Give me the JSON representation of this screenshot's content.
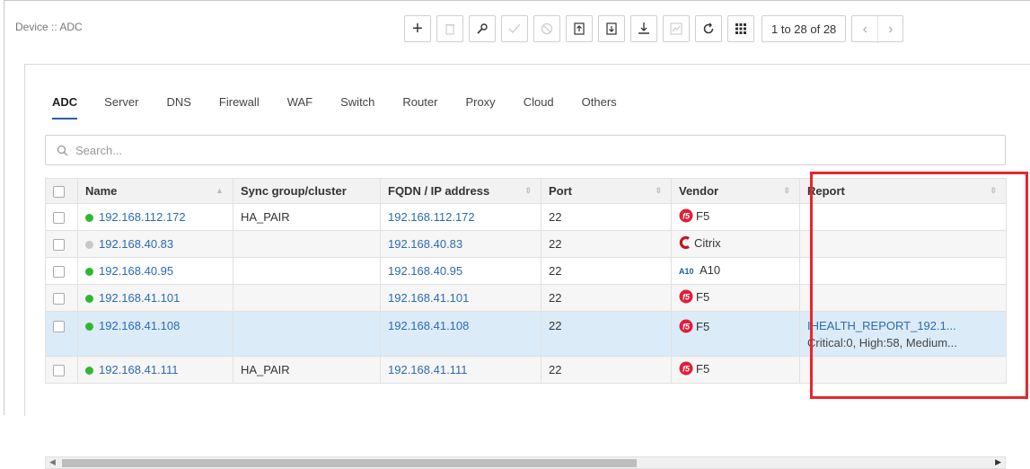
{
  "breadcrumb": "Device :: ADC",
  "toolbar": {
    "buttons": [
      "add-icon",
      "delete-icon",
      "key-icon",
      "check-icon",
      "disable-icon",
      "import-icon",
      "export-icon",
      "download-icon",
      "report-icon",
      "refresh-icon",
      "columns-icon"
    ],
    "add_label": "+",
    "pager_text": "1 to 28 of 28",
    "prev_label": "‹",
    "next_label": "›"
  },
  "tabs": [
    {
      "label": "ADC",
      "active": true
    },
    {
      "label": "Server"
    },
    {
      "label": "DNS"
    },
    {
      "label": "Firewall"
    },
    {
      "label": "WAF"
    },
    {
      "label": "Switch"
    },
    {
      "label": "Router"
    },
    {
      "label": "Proxy"
    },
    {
      "label": "Cloud"
    },
    {
      "label": "Others"
    }
  ],
  "search": {
    "placeholder": "Search..."
  },
  "table": {
    "columns": [
      "Name",
      "Sync group/cluster",
      "FQDN / IP address",
      "Port",
      "Vendor",
      "Report"
    ],
    "rows": [
      {
        "status": "green",
        "name": "192.168.112.172",
        "sync": "HA_PAIR",
        "fqdn": "192.168.112.172",
        "port": "22",
        "vendor": "F5",
        "vendor_icon": "f5-logo-icon",
        "report1": "",
        "report2": ""
      },
      {
        "status": "gray",
        "name": "192.168.40.83",
        "sync": "",
        "fqdn": "192.168.40.83",
        "port": "22",
        "vendor": "Citrix",
        "vendor_icon": "citrix-logo-icon",
        "report1": "",
        "report2": ""
      },
      {
        "status": "green",
        "name": "192.168.40.95",
        "sync": "",
        "fqdn": "192.168.40.95",
        "port": "22",
        "vendor": "A10",
        "vendor_icon": "a10-logo-icon",
        "report1": "",
        "report2": ""
      },
      {
        "status": "green",
        "name": "192.168.41.101",
        "sync": "",
        "fqdn": "192.168.41.101",
        "port": "22",
        "vendor": "F5",
        "vendor_icon": "f5-logo-icon",
        "report1": "",
        "report2": ""
      },
      {
        "status": "green",
        "name": "192.168.41.108",
        "sync": "",
        "fqdn": "192.168.41.108",
        "port": "22",
        "vendor": "F5",
        "vendor_icon": "f5-logo-icon",
        "report1": "IHEALTH_REPORT_192.1...",
        "report2": "Critical:0, High:58, Medium..."
      },
      {
        "status": "green",
        "name": "192.168.41.111",
        "sync": "HA_PAIR",
        "fqdn": "192.168.41.111",
        "port": "22",
        "vendor": "F5",
        "vendor_icon": "f5-logo-icon",
        "report1": "",
        "report2": ""
      }
    ]
  },
  "colors": {
    "accent": "#2a6bb3",
    "status_green": "#2eb82e",
    "status_gray": "#c8c8c8",
    "highlight": "#e8262b",
    "f5_red": "#e21d38"
  }
}
